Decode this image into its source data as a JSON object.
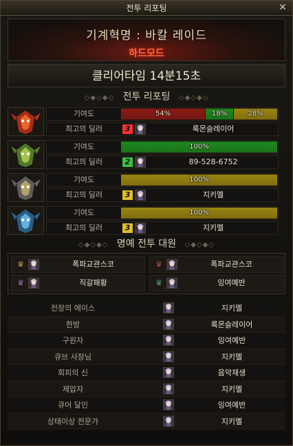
{
  "window": {
    "title": "전투 리포팅",
    "close_glyph": "✕"
  },
  "header": {
    "raid_title": "기계혁명 : 바칼 레이드",
    "mode": "하드모드"
  },
  "clear_time": "클리어타임  14분15초",
  "sections": {
    "report": "전투 리포팅",
    "honor": "명예 전투 대원",
    "decoration": "◇◆◇◆◇"
  },
  "parties": [
    {
      "icon": "fire-dragon-icon",
      "contribution_label": "기여도",
      "segments": [
        {
          "value": 54,
          "label": "54%",
          "color": "#8a1a14"
        },
        {
          "value": 18,
          "label": "18%",
          "color": "#1d8a1d"
        },
        {
          "value": 28,
          "label": "28%",
          "color": "#9a8410"
        }
      ],
      "dealer_label": "최고의 딜러",
      "rank": "3",
      "rank_color": "#ff3030",
      "dealer_name": "룩몬슬레이어"
    },
    {
      "icon": "earth-dragon-icon",
      "contribution_label": "기여도",
      "segments": [
        {
          "value": 100,
          "label": "100%",
          "color": "#1d8a1d"
        }
      ],
      "dealer_label": "최고의 딜러",
      "rank": "2",
      "rank_color": "#3ac03a",
      "dealer_name": "89-528-6752"
    },
    {
      "icon": "metal-dragon-icon",
      "contribution_label": "기여도",
      "segments": [
        {
          "value": 100,
          "label": "100%",
          "color": "#9a8410"
        }
      ],
      "dealer_label": "최고의 딜러",
      "rank": "3",
      "rank_color": "#e0c020",
      "dealer_name": "지키멜"
    },
    {
      "icon": "ice-dragon-icon",
      "contribution_label": "기여도",
      "segments": [
        {
          "value": 100,
          "label": "100%",
          "color": "#9a8410"
        }
      ],
      "dealer_label": "최고의 딜러",
      "rank": "3",
      "rank_color": "#e0c020",
      "dealer_name": "지키멜"
    }
  ],
  "honor_members": [
    {
      "name": "폭파교관스코",
      "crown_color": "#d0a030"
    },
    {
      "name": "폭파교관스코",
      "crown_color": "#b05050"
    },
    {
      "name": "직갈패황",
      "crown_color": "#a070c0"
    },
    {
      "name": "잉여예반",
      "crown_color": "#50a080"
    }
  ],
  "awards": [
    {
      "title": "전장의 에이스",
      "name": "지키멜"
    },
    {
      "title": "한방",
      "name": "룩몬슬레이어"
    },
    {
      "title": "구원자",
      "name": "잉여예반"
    },
    {
      "title": "큐브 사장님",
      "name": "지키멜"
    },
    {
      "title": "회피의 신",
      "name": "음악재생"
    },
    {
      "title": "제압자",
      "name": "지키멜"
    },
    {
      "title": "큐어 달인",
      "name": "잉여예반"
    },
    {
      "title": "상태이상 전문가",
      "name": "지키멜"
    }
  ]
}
